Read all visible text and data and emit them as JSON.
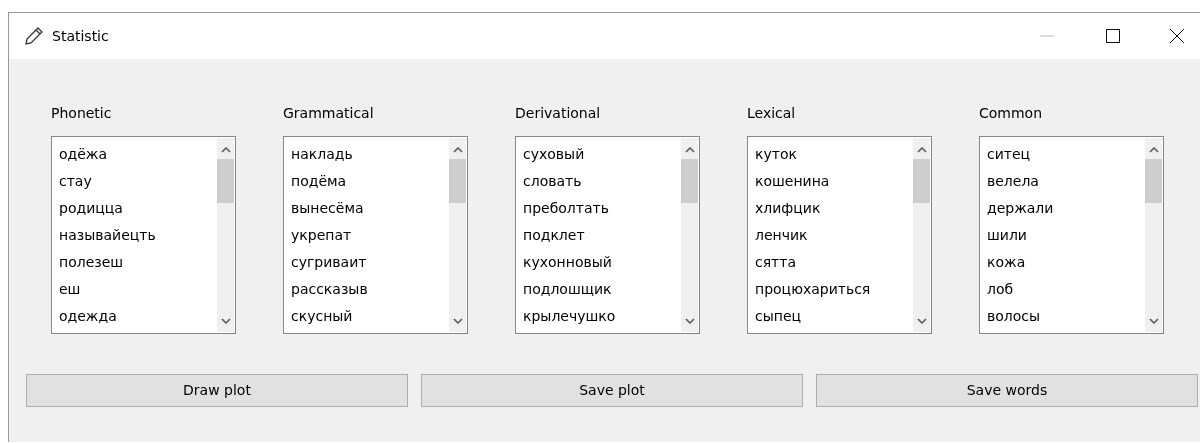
{
  "window": {
    "title": "Statistic"
  },
  "lists": [
    {
      "label": "Phonetic",
      "items": [
        "одёжа",
        "стау",
        "родицца",
        "называйецть",
        "полезеш",
        "еш",
        "одежда"
      ]
    },
    {
      "label": "Grammatical",
      "items": [
        "накладь",
        "подёма",
        "вынесёма",
        "укрепат",
        "сугриваит",
        "рассказыв",
        "скусный"
      ]
    },
    {
      "label": "Derivational",
      "items": [
        "суховый",
        "словать",
        "преболтать",
        "подклет",
        "кухонновый",
        "подлошщик",
        "крылечушко"
      ]
    },
    {
      "label": "Lexical",
      "items": [
        "куток",
        "кошенина",
        "хлифцик",
        "ленчик",
        "сятта",
        "процюхариться",
        "сыпец"
      ]
    },
    {
      "label": "Common",
      "items": [
        "ситец",
        "велела",
        "держали",
        "шили",
        "кожа",
        "лоб",
        "волосы"
      ]
    }
  ],
  "buttons": [
    "Draw plot",
    "Save plot",
    "Save words"
  ]
}
